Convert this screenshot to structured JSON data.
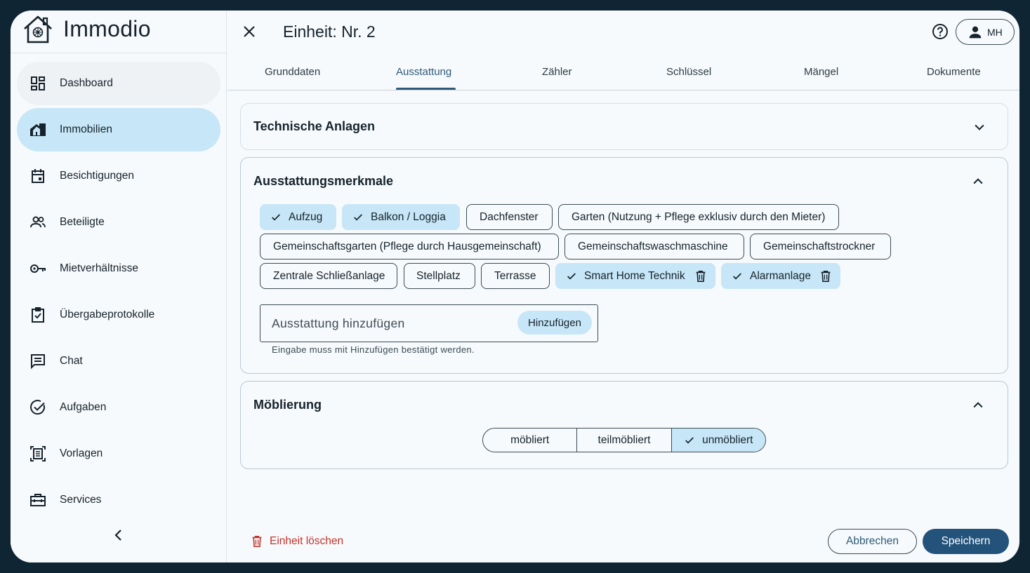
{
  "app": {
    "name": "Immodio"
  },
  "sidebar": {
    "items": [
      {
        "label": "Dashboard",
        "icon": "dashboard-icon"
      },
      {
        "label": "Immobilien",
        "icon": "house-icon",
        "active": true
      },
      {
        "label": "Besichtigungen",
        "icon": "calendar-icon"
      },
      {
        "label": "Beteiligte",
        "icon": "people-icon"
      },
      {
        "label": "Mietverhältnisse",
        "icon": "key-icon"
      },
      {
        "label": "Übergabeprotokolle",
        "icon": "clipboard-check-icon"
      },
      {
        "label": "Chat",
        "icon": "chat-icon"
      },
      {
        "label": "Aufgaben",
        "icon": "check-circle-icon"
      },
      {
        "label": "Vorlagen",
        "icon": "template-icon"
      },
      {
        "label": "Services",
        "icon": "toolbox-icon"
      }
    ]
  },
  "header": {
    "title": "Einheit: Nr. 2",
    "user_initials": "MH"
  },
  "tabs": [
    {
      "label": "Grunddaten"
    },
    {
      "label": "Ausstattung",
      "active": true
    },
    {
      "label": "Zähler"
    },
    {
      "label": "Schlüssel"
    },
    {
      "label": "Mängel"
    },
    {
      "label": "Dokumente"
    }
  ],
  "panels": {
    "technische_anlagen": {
      "title": "Technische Anlagen",
      "expanded": false
    },
    "ausstattung": {
      "title": "Ausstattungsmerkmale",
      "expanded": true,
      "chips": [
        {
          "label": "Aufzug",
          "selected": true,
          "deletable": false
        },
        {
          "label": "Balkon / Loggia",
          "selected": true,
          "deletable": false
        },
        {
          "label": "Dachfenster",
          "selected": false,
          "deletable": false
        },
        {
          "label": "Garten (Nutzung + Pflege exklusiv durch den Mieter)",
          "selected": false,
          "deletable": false
        },
        {
          "label": "Gemeinschaftsgarten (Pflege durch Hausgemeinschaft)",
          "selected": false,
          "deletable": false
        },
        {
          "label": "Gemeinschaftswaschmaschine",
          "selected": false,
          "deletable": false
        },
        {
          "label": "Gemeinschaftstrockner",
          "selected": false,
          "deletable": false
        },
        {
          "label": "Zentrale Schließanlage",
          "selected": false,
          "deletable": false
        },
        {
          "label": "Stellplatz",
          "selected": false,
          "deletable": false
        },
        {
          "label": "Terrasse",
          "selected": false,
          "deletable": false
        },
        {
          "label": "Smart Home Technik",
          "selected": true,
          "deletable": true
        },
        {
          "label": "Alarmanlage",
          "selected": true,
          "deletable": true
        }
      ],
      "add_placeholder": "Ausstattung hinzufügen",
      "add_value": "",
      "add_button": "Hinzufügen",
      "hint": "Eingabe muss mit Hinzufügen bestätigt werden."
    },
    "moeblierung": {
      "title": "Möblierung",
      "expanded": true,
      "options": [
        {
          "label": "möbliert",
          "selected": false
        },
        {
          "label": "teilmöbliert",
          "selected": false
        },
        {
          "label": "unmöbliert",
          "selected": true
        }
      ]
    }
  },
  "footer": {
    "delete_label": "Einheit löschen",
    "cancel_label": "Abbrechen",
    "save_label": "Speichern"
  },
  "colors": {
    "accent": "#23527a",
    "selected_bg": "#c7e6f7",
    "danger": "#c0342c",
    "frame": "#0f2533"
  }
}
